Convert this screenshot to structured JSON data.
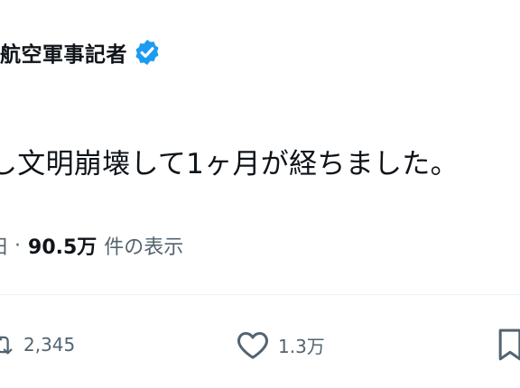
{
  "author": {
    "display_name": "航空軍事記者",
    "verified_icon": "verified-badge-icon",
    "verified_color": "#1d9bf0"
  },
  "tweet": {
    "text": "し文明崩壊して1ヶ月が経ちました。"
  },
  "meta": {
    "date_fragment": "日",
    "separator": "·",
    "views_count": "90.5万",
    "views_label": "件の表示"
  },
  "actions": {
    "retweet_count": "2,345",
    "like_count": "1.3万",
    "retweet_icon": "retweet-icon",
    "like_icon": "heart-icon",
    "bookmark_icon": "bookmark-icon"
  },
  "colors": {
    "text_primary": "#0f1419",
    "text_secondary": "#536471",
    "divider": "#eff3f4"
  }
}
